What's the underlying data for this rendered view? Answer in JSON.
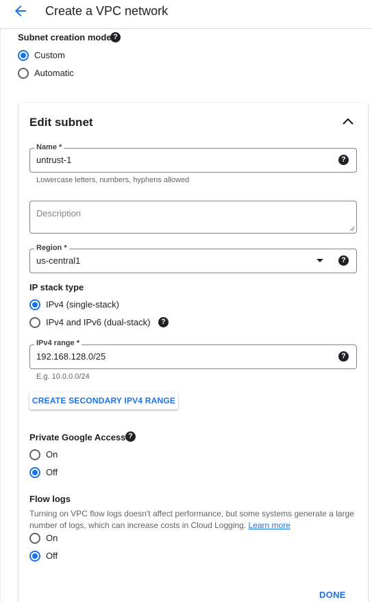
{
  "header": {
    "title": "Create a VPC network"
  },
  "subnet_mode": {
    "label": "Subnet creation mode",
    "options": [
      {
        "label": "Custom",
        "checked": true
      },
      {
        "label": "Automatic",
        "checked": false
      }
    ]
  },
  "edit_subnet": {
    "title": "Edit subnet",
    "name": {
      "label": "Name *",
      "value": "untrust-1",
      "hint": "Lowercase letters, numbers, hyphens allowed"
    },
    "description": {
      "placeholder": "Description",
      "value": ""
    },
    "region": {
      "label": "Region *",
      "value": "us-central1"
    },
    "ip_stack": {
      "label": "IP stack type",
      "options": [
        {
          "label": "IPv4 (single-stack)",
          "checked": true
        },
        {
          "label": "IPv4 and IPv6 (dual-stack)",
          "checked": false
        }
      ]
    },
    "ipv4_range": {
      "label": "IPv4 range *",
      "value": "192.168.128.0/25",
      "hint": "E.g. 10.0.0.0/24"
    },
    "secondary_button": "CREATE SECONDARY IPV4 RANGE",
    "private_google_access": {
      "label": "Private Google Access",
      "options": [
        {
          "label": "On",
          "checked": false
        },
        {
          "label": "Off",
          "checked": true
        }
      ]
    },
    "flow_logs": {
      "label": "Flow logs",
      "description": "Turning on VPC flow logs doesn't affect performance, but some systems generate a large number of logs, which can increase costs in Cloud Logging.",
      "learn_more": "Learn more",
      "options": [
        {
          "label": "On",
          "checked": false
        },
        {
          "label": "Off",
          "checked": true
        }
      ]
    },
    "done_button": "DONE"
  },
  "colors": {
    "accent": "#1a73e8",
    "text": "#202124",
    "secondary_text": "#5f6368",
    "border": "#80868b"
  },
  "icons": [
    "back-arrow-icon",
    "help-icon",
    "chevron-up-icon",
    "dropdown-caret-icon"
  ]
}
